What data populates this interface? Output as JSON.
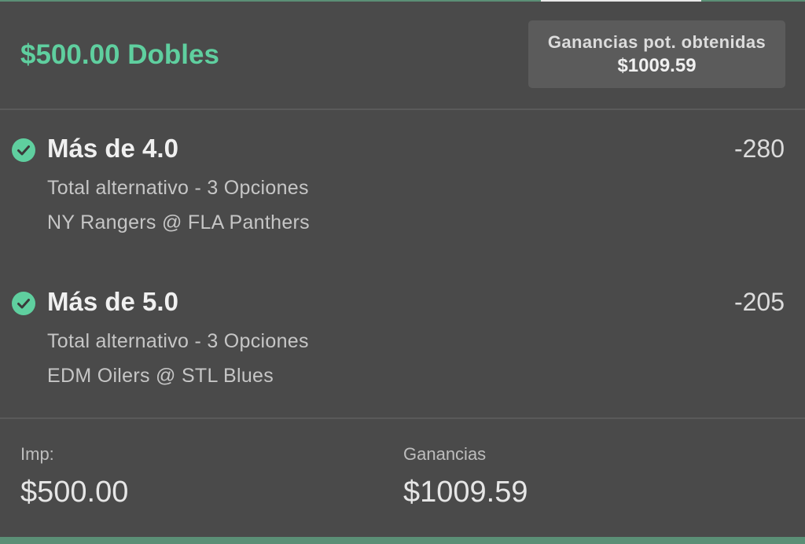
{
  "header": {
    "title": "$500.00 Dobles",
    "potential_winnings_label": "Ganancias pot. obtenidas",
    "potential_winnings_value": "$1009.59"
  },
  "selections": [
    {
      "title": "Más de 4.0",
      "odds": "-280",
      "market": "Total alternativo - 3 Opciones",
      "event": "NY Rangers @ FLA Panthers",
      "status_icon": "check-circle-icon"
    },
    {
      "title": "Más de 5.0",
      "odds": "-205",
      "market": "Total alternativo - 3 Opciones",
      "event": "EDM Oilers @ STL Blues",
      "status_icon": "check-circle-icon"
    }
  ],
  "footer": {
    "stake_label": "Imp:",
    "stake_value": "$500.00",
    "winnings_label": "Ganancias",
    "winnings_value": "$1009.59"
  },
  "colors": {
    "accent_green": "#5fcf9f",
    "background": "#4a4a4a",
    "panel": "#5b5b5b"
  }
}
